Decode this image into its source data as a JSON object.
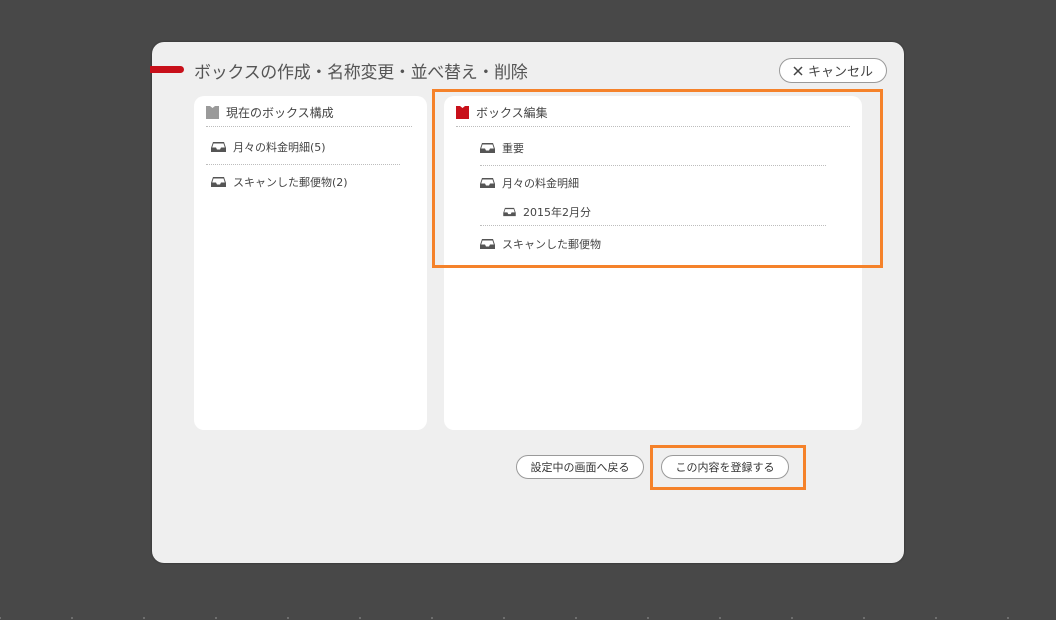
{
  "dialog": {
    "title": "ボックスの作成・名称変更・並べ替え・削除",
    "cancel_label": "キャンセル"
  },
  "current_boxes": {
    "header": "現在のボックス構成",
    "items": [
      {
        "label": "月々の料金明細(5)"
      },
      {
        "label": "スキャンした郵便物(2)"
      }
    ]
  },
  "box_edit": {
    "header": "ボックス編集",
    "items": [
      {
        "label": "重要"
      },
      {
        "label": "月々の料金明細"
      },
      {
        "label": "2015年2月分"
      },
      {
        "label": "スキャンした郵便物"
      }
    ]
  },
  "footer": {
    "back_label": "設定中の画面へ戻る",
    "register_label": "この内容を登録する"
  },
  "colors": {
    "accent_red": "#c8101a",
    "highlight_orange": "#f5822a",
    "backdrop": "#484848",
    "dialog_bg": "#efefef"
  },
  "icons": {
    "tray": "inbox-tray-icon",
    "box_header_gray": "box-icon",
    "box_header_red": "box-icon",
    "cancel": "close-icon"
  }
}
